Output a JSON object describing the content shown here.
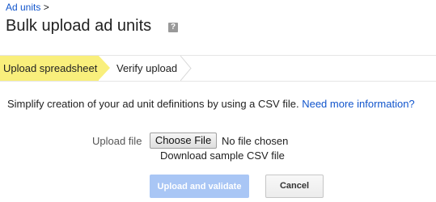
{
  "breadcrumb": {
    "parent": "Ad units",
    "separator": ">"
  },
  "page": {
    "title": "Bulk upload ad units",
    "help_icon": "?"
  },
  "steps": [
    {
      "label": "Upload spreadsheet",
      "active": true
    },
    {
      "label": "Verify upload",
      "active": false
    }
  ],
  "intro": {
    "text": "Simplify creation of your ad unit definitions by using a CSV file.",
    "link": "Need more information?"
  },
  "upload": {
    "label": "Upload file",
    "choose_button": "Choose File",
    "no_file_text": "No file chosen",
    "download_link": "Download sample CSV file"
  },
  "actions": {
    "submit": "Upload and validate",
    "cancel": "Cancel"
  },
  "colors": {
    "active_step": "#f9ef7c",
    "link": "#1155cc",
    "primary_disabled": "#a9c6f5"
  }
}
